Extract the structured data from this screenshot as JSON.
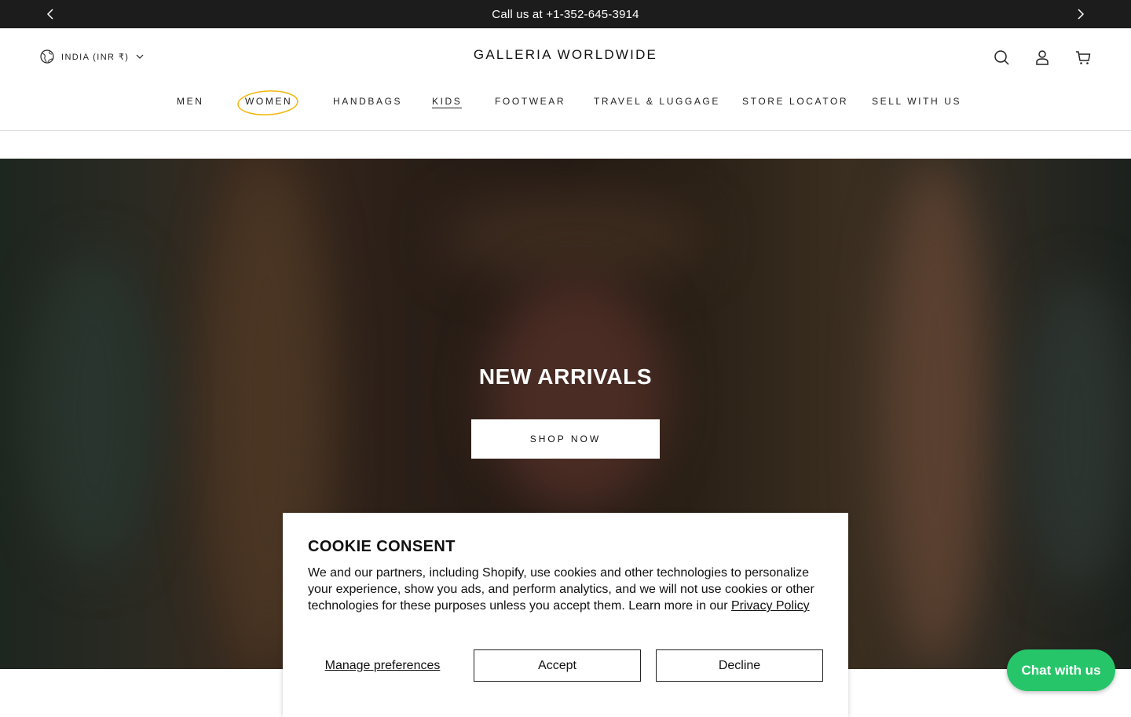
{
  "announcement": {
    "text": "Call us at +1-352-645-3914"
  },
  "header": {
    "country": "INDIA (INR ₹)",
    "logo": "GALLERIA WORLDWIDE"
  },
  "nav": {
    "items": [
      "MEN",
      "WOMEN",
      "HANDBAGS",
      "KIDS",
      "FOOTWEAR",
      "TRAVEL & LUGGAGE",
      "STORE LOCATOR",
      "SELL WITH US"
    ],
    "active": "KIDS",
    "highlighted": "WOMEN",
    "highlight_color": "#f2b70b"
  },
  "hero": {
    "title": "NEW ARRIVALS",
    "button": "SHOP NOW"
  },
  "cookie": {
    "title": "COOKIE CONSENT",
    "body": "We and our partners, including Shopify, use cookies and other technologies to personalize your experience, show you ads, and perform analytics, and we will not use cookies or other technologies for these purposes unless you accept them. Learn more in our",
    "link": "Privacy Policy",
    "manage": "Manage preferences",
    "accept": "Accept",
    "decline": "Decline"
  },
  "chat": {
    "label": "Chat with us",
    "color": "#27c56a"
  },
  "colors": {
    "announcement_bg": "#1c1c1c",
    "text": "#121212"
  }
}
